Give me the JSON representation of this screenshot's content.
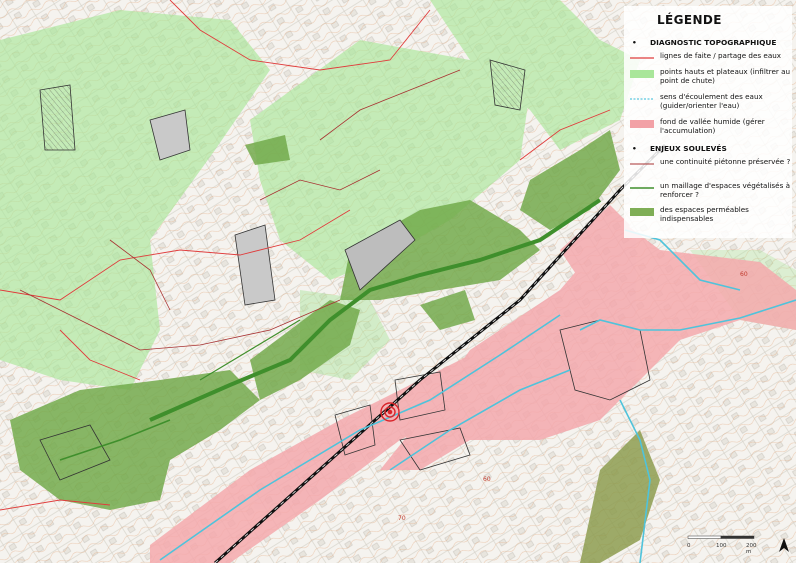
{
  "legend": {
    "title": "LÉGENDE",
    "sections": [
      {
        "heading": "DIAGNOSTIC TOPOGRAPHIQUE",
        "items": [
          {
            "label": "lignes de faite / partage des eaux",
            "symbol": "red-line",
            "color": "#e03c3c"
          },
          {
            "label": "points hauts et plateaux (infiltrer au point de chute)",
            "symbol": "light-green-fill",
            "color": "#a9e69a"
          },
          {
            "label": "sens d'écoulement des eaux (guider/orienter l'eau)",
            "symbol": "cyan-line",
            "color": "#5bc8e0"
          },
          {
            "label": "fond de vallée humide (gérer l'accumulation)",
            "symbol": "pink-fill",
            "color": "#f2a1a6"
          }
        ]
      },
      {
        "heading": "ENJEUX SOULEVÉS",
        "items": [
          {
            "label": "une continuité piétonne préservée ?",
            "symbol": "dark-red-line",
            "color": "#a83232"
          },
          {
            "label": "un maillage d'espaces végétalisés à renforcer ?",
            "symbol": "green-line",
            "color": "#3f8f2c"
          },
          {
            "label": "des espaces perméables indispensables",
            "symbol": "olive-fill",
            "color": "#7fae56"
          }
        ]
      }
    ]
  },
  "map_labels": {
    "contour_a": "60",
    "contour_b": "70",
    "contour_c": "60"
  },
  "scale": {
    "labels": [
      "0",
      "100",
      "200 m"
    ]
  },
  "north_arrow": "north-arrow-icon"
}
